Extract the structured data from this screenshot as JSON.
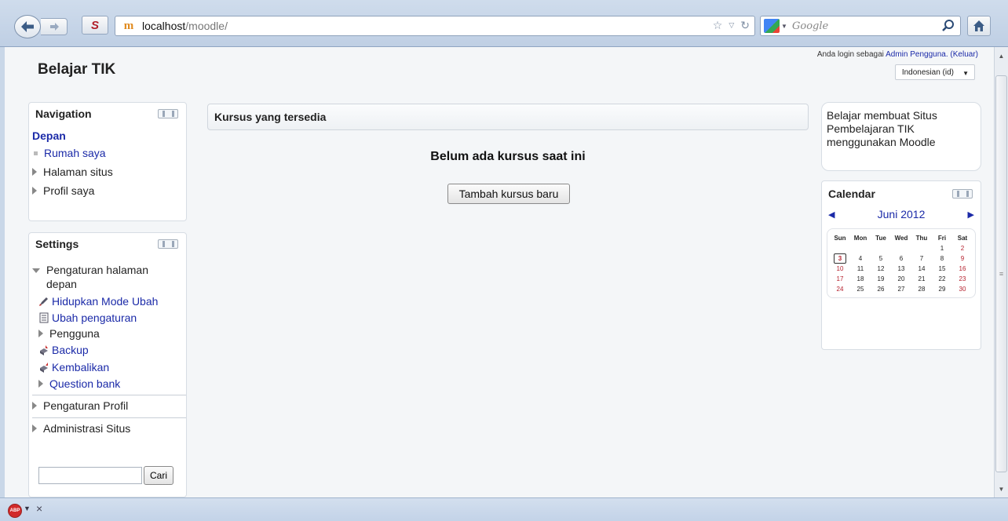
{
  "browser": {
    "url_host": "localhost",
    "url_path": "/moodle/",
    "search_placeholder": "Google",
    "ext_label": "S",
    "site_icon_label": "m"
  },
  "header": {
    "site_title": "Belajar TIK",
    "login_prefix": "Anda login sebagai ",
    "login_user": "Admin Pengguna.",
    "logout": "(Keluar)",
    "language": "Indonesian (id)"
  },
  "navigation": {
    "title": "Navigation",
    "home": "Depan",
    "items": [
      {
        "label": "Rumah saya"
      },
      {
        "label": "Halaman situs"
      },
      {
        "label": "Profil saya"
      }
    ]
  },
  "settings": {
    "title": "Settings",
    "section": "Pengaturan halaman depan",
    "items": [
      {
        "label": "Hidupkan Mode Ubah"
      },
      {
        "label": "Ubah pengaturan"
      },
      {
        "label": "Pengguna"
      },
      {
        "label": "Backup"
      },
      {
        "label": "Kembalikan"
      },
      {
        "label": "Question bank"
      }
    ],
    "profile": "Pengaturan Profil",
    "admin": "Administrasi Situs",
    "search_button": "Cari"
  },
  "main": {
    "heading": "Kursus yang tersedia",
    "empty_message": "Belum ada kursus saat ini",
    "add_button": "Tambah kursus baru"
  },
  "about": {
    "text": "Belajar membuat Situs Pembelajaran TIK menggunakan Moodle"
  },
  "calendar": {
    "title": "Calendar",
    "month": "Juni 2012",
    "days": [
      "Sun",
      "Mon",
      "Tue",
      "Wed",
      "Thu",
      "Fri",
      "Sat"
    ],
    "weeks": [
      [
        "",
        "",
        "",
        "",
        "",
        "1",
        "2"
      ],
      [
        "3",
        "4",
        "5",
        "6",
        "7",
        "8",
        "9"
      ],
      [
        "10",
        "11",
        "12",
        "13",
        "14",
        "15",
        "16"
      ],
      [
        "17",
        "18",
        "19",
        "20",
        "21",
        "22",
        "23"
      ],
      [
        "24",
        "25",
        "26",
        "27",
        "28",
        "29",
        "30"
      ]
    ],
    "today": "3"
  },
  "statusbar": {
    "abp_label": "ABP"
  },
  "colors": {
    "link": "#1b2aa8",
    "weekend": "#b41f2c"
  }
}
